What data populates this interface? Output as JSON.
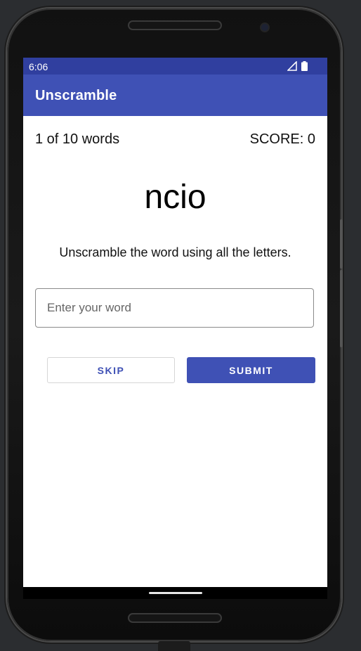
{
  "status_bar": {
    "time": "6:06",
    "icons": [
      "signal-icon",
      "battery-icon"
    ]
  },
  "app_bar": {
    "title": "Unscramble"
  },
  "game": {
    "word_count": "1 of 10 words",
    "score": "SCORE: 0",
    "scrambled_word": "ncio",
    "instructions": "Unscramble the word using all the letters.",
    "input_value": "",
    "input_placeholder": "Enter your word",
    "skip_label": "SKIP",
    "submit_label": "SUBMIT"
  },
  "colors": {
    "primary": "#3f51b5",
    "primary_dark": "#303f9f",
    "background": "#ffffff"
  }
}
